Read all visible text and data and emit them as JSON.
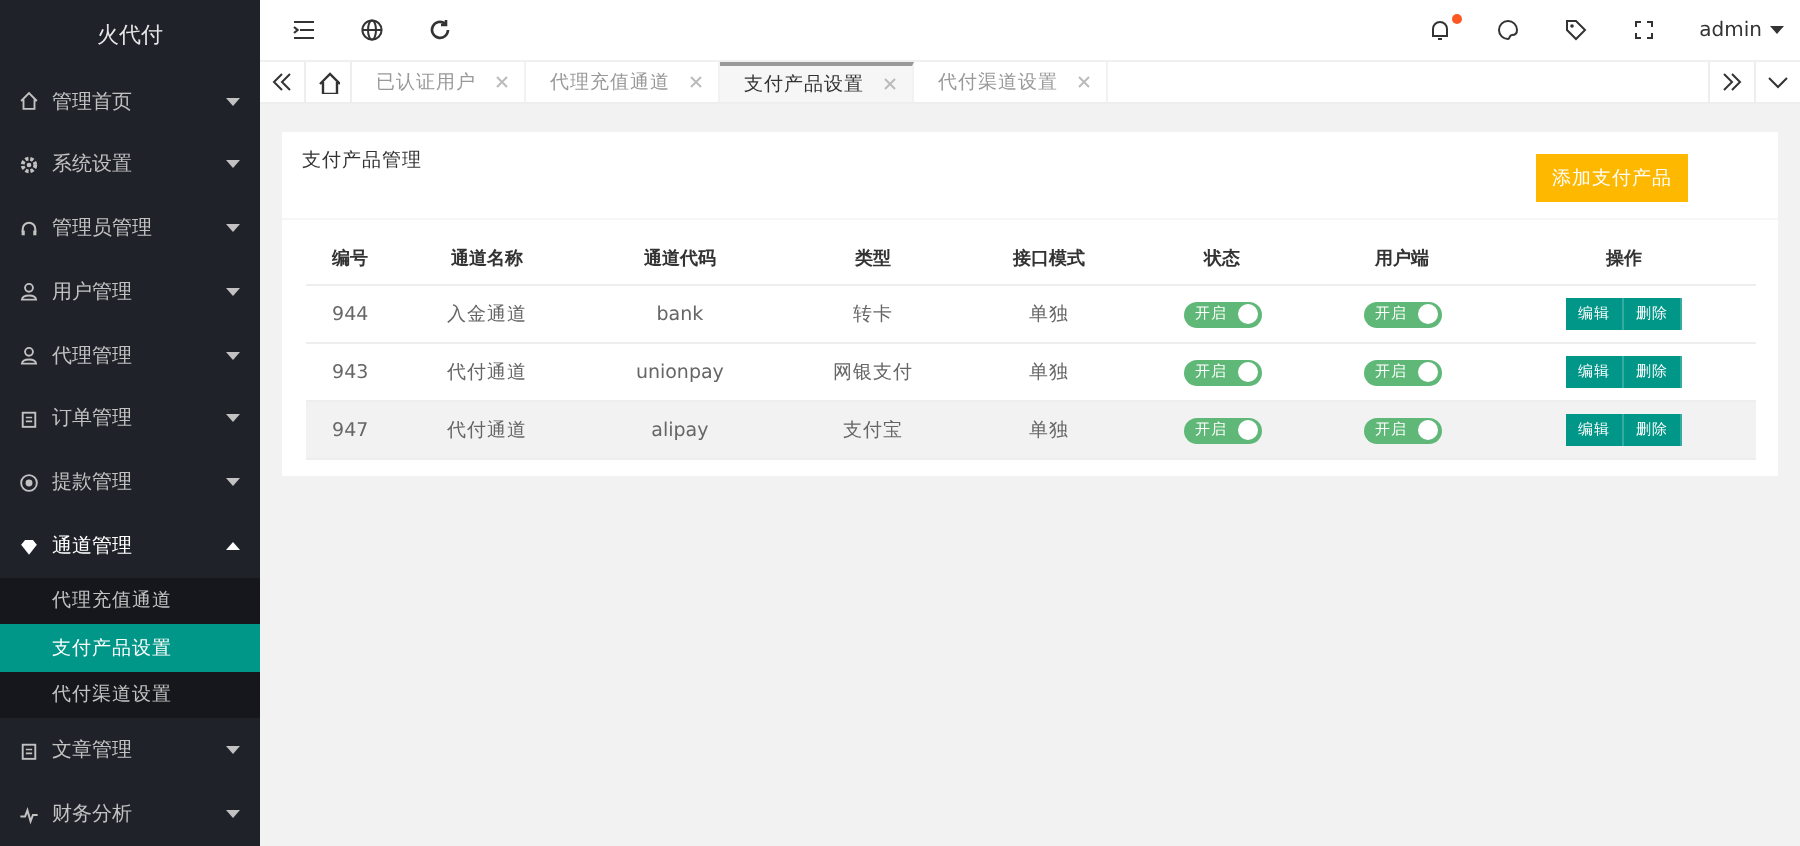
{
  "sidebar": {
    "logo": "火代付",
    "items": [
      {
        "label": "管理首页",
        "expanded": false
      },
      {
        "label": "系统设置",
        "expanded": false
      },
      {
        "label": "管理员管理",
        "expanded": false
      },
      {
        "label": "用户管理",
        "expanded": false
      },
      {
        "label": "代理管理",
        "expanded": false
      },
      {
        "label": "订单管理",
        "expanded": false
      },
      {
        "label": "提款管理",
        "expanded": false
      },
      {
        "label": "通道管理",
        "expanded": true,
        "children": [
          {
            "label": "代理充值通道",
            "selected": false
          },
          {
            "label": "支付产品设置",
            "selected": true
          },
          {
            "label": "代付渠道设置",
            "selected": false
          }
        ]
      },
      {
        "label": "文章管理",
        "expanded": false
      },
      {
        "label": "财务分析",
        "expanded": false
      }
    ]
  },
  "topbar": {
    "user": "admin",
    "notification_dot": true
  },
  "tabs": [
    {
      "label": "已认证用户",
      "selected": false
    },
    {
      "label": "代理充值通道",
      "selected": false
    },
    {
      "label": "支付产品设置",
      "selected": true
    },
    {
      "label": "代付渠道设置",
      "selected": false
    }
  ],
  "panel": {
    "title": "支付产品管理",
    "add_button": "添加支付产品",
    "columns": [
      "编号",
      "通道名称",
      "通道代码",
      "类型",
      "接口模式",
      "状态",
      "用户端",
      "操作"
    ],
    "rows": [
      {
        "id": "944",
        "name": "入金通道",
        "code": "bank",
        "type": "转卡",
        "mode": "单独",
        "status": {
          "label": "开启",
          "on": true
        },
        "client": {
          "label": "开启",
          "on": true
        },
        "edit": "编辑",
        "delete": "删除",
        "highlighted": false
      },
      {
        "id": "943",
        "name": "代付通道",
        "code": "unionpay",
        "type": "网银支付",
        "mode": "单独",
        "status": {
          "label": "开启",
          "on": true
        },
        "client": {
          "label": "开启",
          "on": true
        },
        "edit": "编辑",
        "delete": "删除",
        "highlighted": false
      },
      {
        "id": "947",
        "name": "代付通道",
        "code": "alipay",
        "type": "支付宝",
        "mode": "单独",
        "status": {
          "label": "开启",
          "on": true
        },
        "client": {
          "label": "开启",
          "on": true
        },
        "edit": "编辑",
        "delete": "删除",
        "highlighted": true
      }
    ]
  }
}
